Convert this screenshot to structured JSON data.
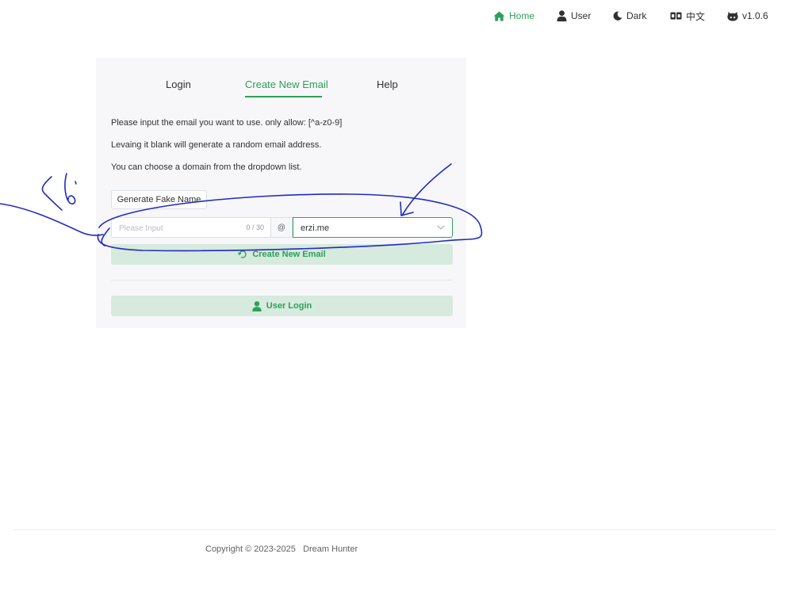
{
  "nav": {
    "home": "Home",
    "user": "User",
    "dark": "Dark",
    "lang": "中文",
    "version": "v1.0.6"
  },
  "tabs": {
    "login": "Login",
    "create": "Create New Email",
    "help": "Help"
  },
  "form": {
    "info_lines": [
      "Please input the email you want to use. only allow: [^a-z0-9]",
      "Levaing it blank will generate a random email address.",
      "You can choose a domain from the dropdown list."
    ],
    "fake_name_button": "Generate Fake Name",
    "input_placeholder": "Please Input",
    "input_value": "",
    "char_count": "0 / 30",
    "at_sign": "@",
    "domain_selected": "erzi.me",
    "create_button": "Create New Email",
    "user_login_button": "User Login"
  },
  "footer": {
    "copyright": "Copyright © 2023-2025   Dream Hunter"
  },
  "colors": {
    "accent": "#2da05a",
    "accent_light": "#d6eadd",
    "card_bg": "#f7f7f9",
    "annotation_ink": "#1f2bc2"
  },
  "icons": [
    "home-icon",
    "user-icon",
    "moon-icon",
    "translate-icon",
    "github-icon",
    "chevron-down-icon",
    "refresh-icon",
    "user-icon"
  ]
}
